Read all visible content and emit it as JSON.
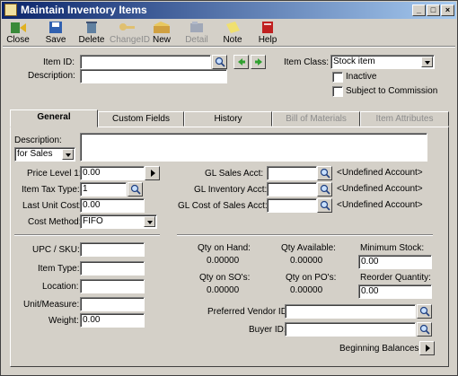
{
  "window": {
    "title": "Maintain Inventory Items"
  },
  "toolbar": {
    "close": "Close",
    "save": "Save",
    "delete": "Delete",
    "change_id": "ChangeID",
    "new": "New",
    "detail": "Detail",
    "note": "Note",
    "help": "Help"
  },
  "header": {
    "item_id_label": "Item ID:",
    "item_id_value": "",
    "description_label": "Description:",
    "description_value": "",
    "item_class_label": "Item Class:",
    "item_class_value": "Stock item",
    "inactive_label": "Inactive",
    "commission_label": "Subject to Commission"
  },
  "tabs": [
    {
      "label": "General"
    },
    {
      "label": "Custom Fields"
    },
    {
      "label": "History"
    },
    {
      "label": "Bill of Materials"
    },
    {
      "label": "Item Attributes"
    }
  ],
  "general": {
    "description_label": "Description:",
    "description_for": "for Sales",
    "description_value": "",
    "price_level_label": "Price Level 1:",
    "price_level_value": "0.00",
    "tax_type_label": "Item Tax Type:",
    "tax_type_value": "1",
    "last_cost_label": "Last Unit Cost:",
    "last_cost_value": "0.00",
    "cost_method_label": "Cost Method:",
    "cost_method_value": "FIFO",
    "gl_sales_label": "GL Sales Acct:",
    "gl_sales_status": "<Undefined Account>",
    "gl_inventory_label": "GL Inventory Acct:",
    "gl_inventory_status": "<Undefined Account>",
    "gl_cogs_label": "GL Cost of Sales Acct:",
    "gl_cogs_status": "<Undefined Account>",
    "upc_label": "UPC / SKU:",
    "upc_value": "",
    "item_type_label": "Item Type:",
    "item_type_value": "",
    "location_label": "Location:",
    "location_value": "",
    "unit_label": "Unit/Measure:",
    "unit_value": "",
    "weight_label": "Weight:",
    "weight_value": "0.00",
    "qty_on_hand_label": "Qty on Hand:",
    "qty_on_hand_value": "0.00000",
    "qty_available_label": "Qty Available:",
    "qty_available_value": "0.00000",
    "min_stock_label": "Minimum Stock:",
    "min_stock_value": "0.00",
    "qty_on_so_label": "Qty on SO's:",
    "qty_on_so_value": "0.00000",
    "qty_on_po_label": "Qty on PO's:",
    "qty_on_po_value": "0.00000",
    "reorder_label": "Reorder Quantity:",
    "reorder_value": "0.00",
    "pref_vendor_label": "Preferred Vendor ID:",
    "pref_vendor_value": "",
    "buyer_label": "Buyer ID:",
    "buyer_value": "",
    "beginning_balances_label": "Beginning Balances:"
  }
}
